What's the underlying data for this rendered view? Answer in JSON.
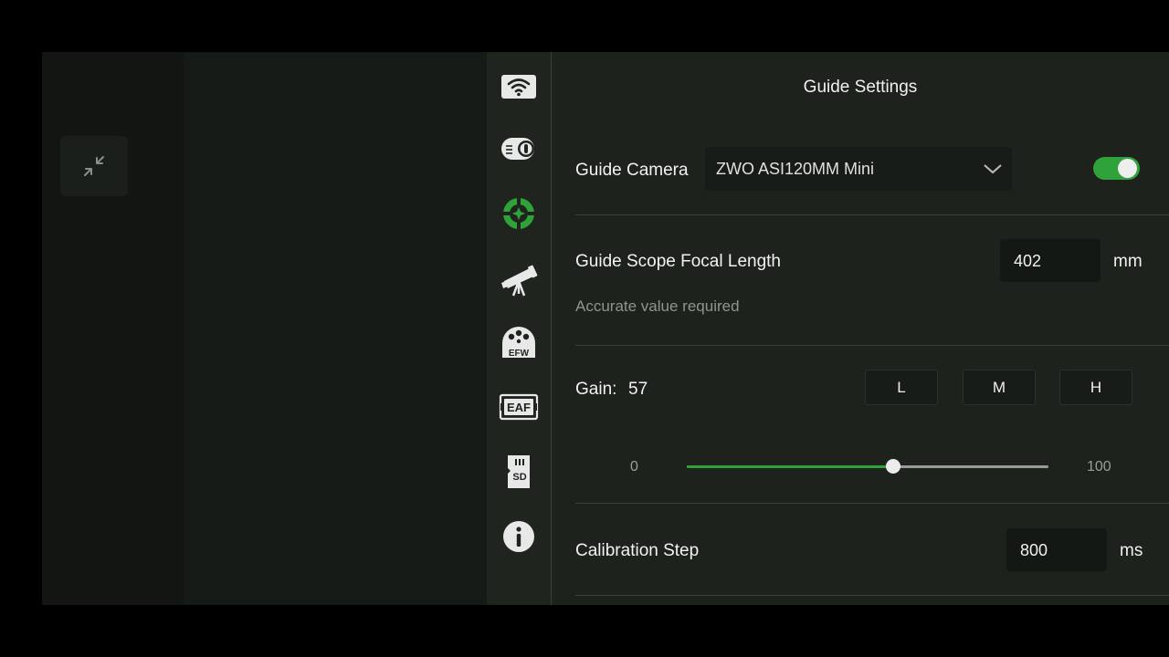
{
  "rail": {
    "items": [
      {
        "name": "wifi"
      },
      {
        "name": "main-camera"
      },
      {
        "name": "guide",
        "active": true
      },
      {
        "name": "telescope"
      },
      {
        "name": "efw",
        "label": "EFW"
      },
      {
        "name": "eaf",
        "label": "EAF"
      },
      {
        "name": "sd",
        "label": "SD"
      },
      {
        "name": "info"
      }
    ]
  },
  "settings": {
    "title": "Guide Settings",
    "guide_camera": {
      "label": "Guide Camera",
      "value": "ZWO ASI120MM Mini",
      "enabled": true
    },
    "focal_length": {
      "label": "Guide Scope Focal Length",
      "value": "402",
      "unit": "mm",
      "hint": "Accurate value required"
    },
    "gain": {
      "label": "Gain:",
      "value": "57",
      "presets": [
        "L",
        "M",
        "H"
      ],
      "min": "0",
      "max": "100",
      "level": 57
    },
    "calibration": {
      "label": "Calibration Step",
      "value": "800",
      "unit": "ms"
    }
  },
  "colors": {
    "accent": "#2fa33a",
    "panel": "#1d221d"
  }
}
